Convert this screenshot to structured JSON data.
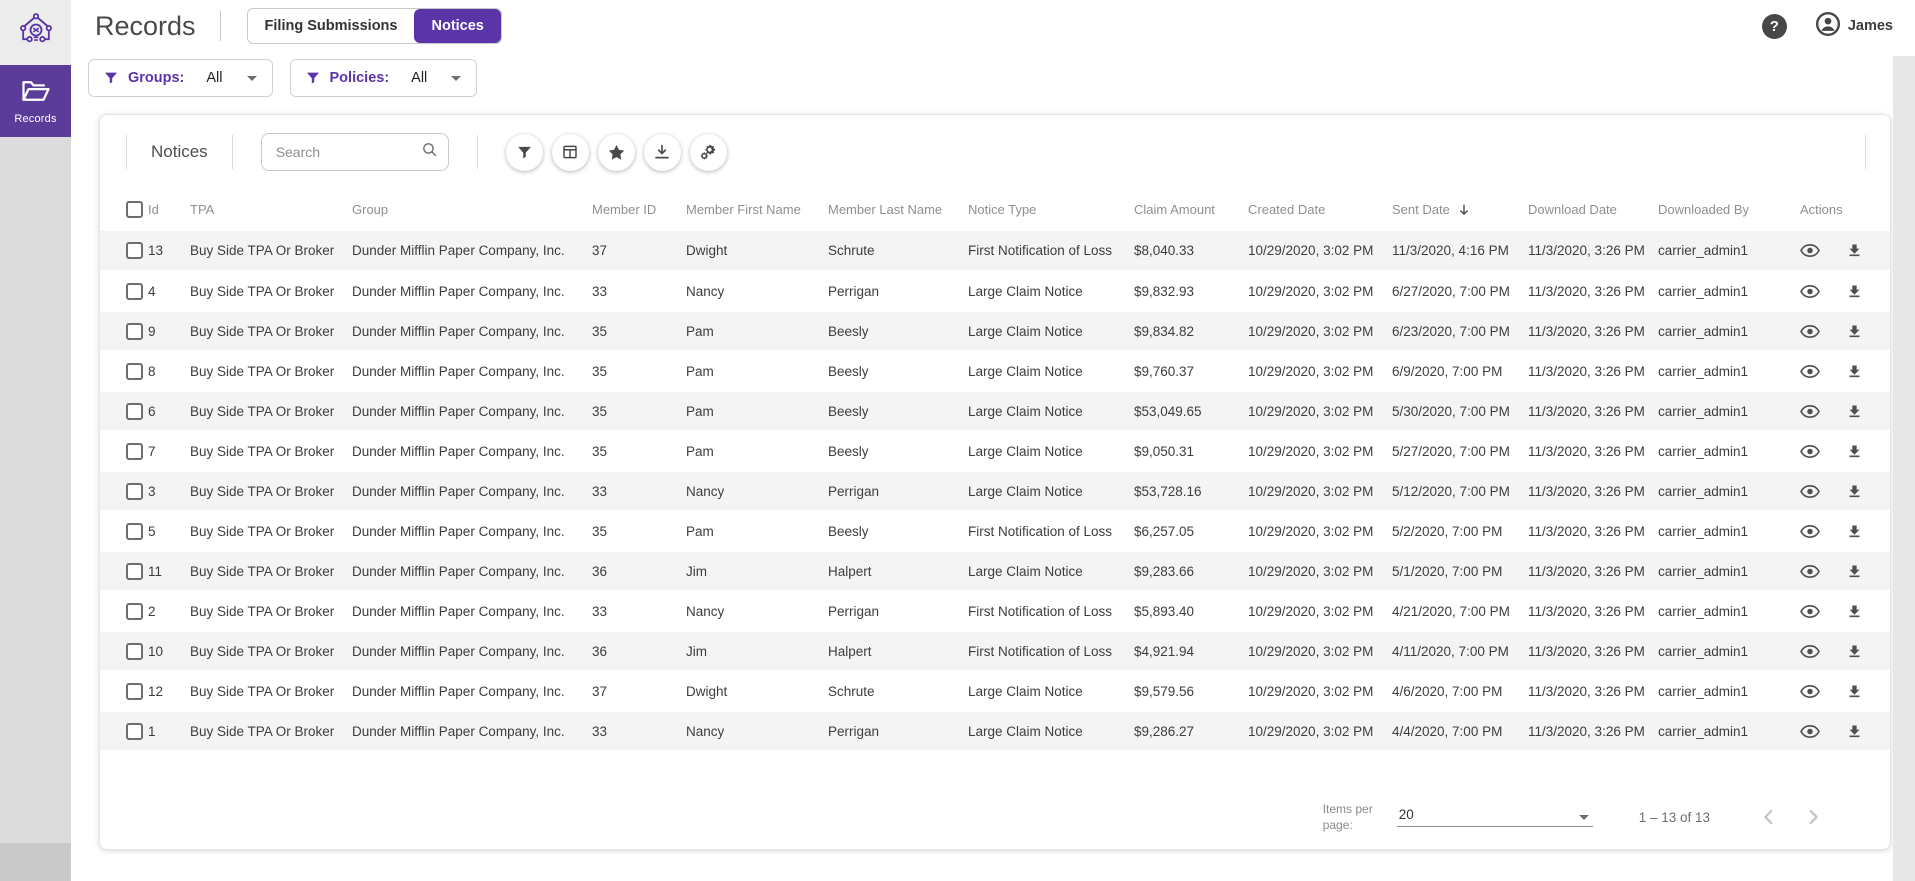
{
  "app": {
    "title": "Records",
    "help_label": "?",
    "user_name": "James"
  },
  "sidebar": {
    "records_label": "Records"
  },
  "tabs": [
    {
      "label": "Filing Submissions",
      "active": false
    },
    {
      "label": "Notices",
      "active": true
    }
  ],
  "filters": [
    {
      "label": "Groups:",
      "value": "All"
    },
    {
      "label": "Policies:",
      "value": "All"
    }
  ],
  "panel": {
    "title": "Notices",
    "search_placeholder": "Search",
    "toolbar_icons": [
      "filter-icon",
      "columns-icon",
      "favorite-star-icon",
      "download-icon",
      "settings-gears-icon"
    ]
  },
  "table": {
    "columns": [
      {
        "key": "select",
        "label": ""
      },
      {
        "key": "id",
        "label": "Id"
      },
      {
        "key": "tpa",
        "label": "TPA"
      },
      {
        "key": "group",
        "label": "Group"
      },
      {
        "key": "member_id",
        "label": "Member ID"
      },
      {
        "key": "member_first_name",
        "label": "Member First Name"
      },
      {
        "key": "member_last_name",
        "label": "Member Last Name"
      },
      {
        "key": "notice_type",
        "label": "Notice Type"
      },
      {
        "key": "claim_amount",
        "label": "Claim Amount"
      },
      {
        "key": "created_date",
        "label": "Created Date"
      },
      {
        "key": "sent_date",
        "label": "Sent Date",
        "sorted": "desc"
      },
      {
        "key": "download_date",
        "label": "Download Date"
      },
      {
        "key": "downloaded_by",
        "label": "Downloaded By"
      },
      {
        "key": "actions",
        "label": "Actions"
      }
    ],
    "rows": [
      {
        "id": "13",
        "tpa": "Buy Side TPA Or Broker",
        "group": "Dunder Mifflin Paper Company, Inc.",
        "member_id": "37",
        "member_first_name": "Dwight",
        "member_last_name": "Schrute",
        "notice_type": "First Notification of Loss",
        "claim_amount": "$8,040.33",
        "created_date": "10/29/2020, 3:02 PM",
        "sent_date": "11/3/2020, 4:16 PM",
        "download_date": "11/3/2020, 3:26 PM",
        "downloaded_by": "carrier_admin1"
      },
      {
        "id": "4",
        "tpa": "Buy Side TPA Or Broker",
        "group": "Dunder Mifflin Paper Company, Inc.",
        "member_id": "33",
        "member_first_name": "Nancy",
        "member_last_name": "Perrigan",
        "notice_type": "Large Claim Notice",
        "claim_amount": "$9,832.93",
        "created_date": "10/29/2020, 3:02 PM",
        "sent_date": "6/27/2020, 7:00 PM",
        "download_date": "11/3/2020, 3:26 PM",
        "downloaded_by": "carrier_admin1"
      },
      {
        "id": "9",
        "tpa": "Buy Side TPA Or Broker",
        "group": "Dunder Mifflin Paper Company, Inc.",
        "member_id": "35",
        "member_first_name": "Pam",
        "member_last_name": "Beesly",
        "notice_type": "Large Claim Notice",
        "claim_amount": "$9,834.82",
        "created_date": "10/29/2020, 3:02 PM",
        "sent_date": "6/23/2020, 7:00 PM",
        "download_date": "11/3/2020, 3:26 PM",
        "downloaded_by": "carrier_admin1"
      },
      {
        "id": "8",
        "tpa": "Buy Side TPA Or Broker",
        "group": "Dunder Mifflin Paper Company, Inc.",
        "member_id": "35",
        "member_first_name": "Pam",
        "member_last_name": "Beesly",
        "notice_type": "Large Claim Notice",
        "claim_amount": "$9,760.37",
        "created_date": "10/29/2020, 3:02 PM",
        "sent_date": "6/9/2020, 7:00 PM",
        "download_date": "11/3/2020, 3:26 PM",
        "downloaded_by": "carrier_admin1"
      },
      {
        "id": "6",
        "tpa": "Buy Side TPA Or Broker",
        "group": "Dunder Mifflin Paper Company, Inc.",
        "member_id": "35",
        "member_first_name": "Pam",
        "member_last_name": "Beesly",
        "notice_type": "Large Claim Notice",
        "claim_amount": "$53,049.65",
        "created_date": "10/29/2020, 3:02 PM",
        "sent_date": "5/30/2020, 7:00 PM",
        "download_date": "11/3/2020, 3:26 PM",
        "downloaded_by": "carrier_admin1"
      },
      {
        "id": "7",
        "tpa": "Buy Side TPA Or Broker",
        "group": "Dunder Mifflin Paper Company, Inc.",
        "member_id": "35",
        "member_first_name": "Pam",
        "member_last_name": "Beesly",
        "notice_type": "Large Claim Notice",
        "claim_amount": "$9,050.31",
        "created_date": "10/29/2020, 3:02 PM",
        "sent_date": "5/27/2020, 7:00 PM",
        "download_date": "11/3/2020, 3:26 PM",
        "downloaded_by": "carrier_admin1"
      },
      {
        "id": "3",
        "tpa": "Buy Side TPA Or Broker",
        "group": "Dunder Mifflin Paper Company, Inc.",
        "member_id": "33",
        "member_first_name": "Nancy",
        "member_last_name": "Perrigan",
        "notice_type": "Large Claim Notice",
        "claim_amount": "$53,728.16",
        "created_date": "10/29/2020, 3:02 PM",
        "sent_date": "5/12/2020, 7:00 PM",
        "download_date": "11/3/2020, 3:26 PM",
        "downloaded_by": "carrier_admin1"
      },
      {
        "id": "5",
        "tpa": "Buy Side TPA Or Broker",
        "group": "Dunder Mifflin Paper Company, Inc.",
        "member_id": "35",
        "member_first_name": "Pam",
        "member_last_name": "Beesly",
        "notice_type": "First Notification of Loss",
        "claim_amount": "$6,257.05",
        "created_date": "10/29/2020, 3:02 PM",
        "sent_date": "5/2/2020, 7:00 PM",
        "download_date": "11/3/2020, 3:26 PM",
        "downloaded_by": "carrier_admin1"
      },
      {
        "id": "11",
        "tpa": "Buy Side TPA Or Broker",
        "group": "Dunder Mifflin Paper Company, Inc.",
        "member_id": "36",
        "member_first_name": "Jim",
        "member_last_name": "Halpert",
        "notice_type": "Large Claim Notice",
        "claim_amount": "$9,283.66",
        "created_date": "10/29/2020, 3:02 PM",
        "sent_date": "5/1/2020, 7:00 PM",
        "download_date": "11/3/2020, 3:26 PM",
        "downloaded_by": "carrier_admin1"
      },
      {
        "id": "2",
        "tpa": "Buy Side TPA Or Broker",
        "group": "Dunder Mifflin Paper Company, Inc.",
        "member_id": "33",
        "member_first_name": "Nancy",
        "member_last_name": "Perrigan",
        "notice_type": "First Notification of Loss",
        "claim_amount": "$5,893.40",
        "created_date": "10/29/2020, 3:02 PM",
        "sent_date": "4/21/2020, 7:00 PM",
        "download_date": "11/3/2020, 3:26 PM",
        "downloaded_by": "carrier_admin1"
      },
      {
        "id": "10",
        "tpa": "Buy Side TPA Or Broker",
        "group": "Dunder Mifflin Paper Company, Inc.",
        "member_id": "36",
        "member_first_name": "Jim",
        "member_last_name": "Halpert",
        "notice_type": "First Notification of Loss",
        "claim_amount": "$4,921.94",
        "created_date": "10/29/2020, 3:02 PM",
        "sent_date": "4/11/2020, 7:00 PM",
        "download_date": "11/3/2020, 3:26 PM",
        "downloaded_by": "carrier_admin1"
      },
      {
        "id": "12",
        "tpa": "Buy Side TPA Or Broker",
        "group": "Dunder Mifflin Paper Company, Inc.",
        "member_id": "37",
        "member_first_name": "Dwight",
        "member_last_name": "Schrute",
        "notice_type": "Large Claim Notice",
        "claim_amount": "$9,579.56",
        "created_date": "10/29/2020, 3:02 PM",
        "sent_date": "4/6/2020, 7:00 PM",
        "download_date": "11/3/2020, 3:26 PM",
        "downloaded_by": "carrier_admin1"
      },
      {
        "id": "1",
        "tpa": "Buy Side TPA Or Broker",
        "group": "Dunder Mifflin Paper Company, Inc.",
        "member_id": "33",
        "member_first_name": "Nancy",
        "member_last_name": "Perrigan",
        "notice_type": "Large Claim Notice",
        "claim_amount": "$9,286.27",
        "created_date": "10/29/2020, 3:02 PM",
        "sent_date": "4/4/2020, 7:00 PM",
        "download_date": "11/3/2020, 3:26 PM",
        "downloaded_by": "carrier_admin1"
      }
    ]
  },
  "pagination": {
    "items_per_page_label": "Items per page:",
    "page_size": "20",
    "range": "1 – 13 of 13"
  },
  "colors": {
    "accent_purple": "#5b34a8",
    "sidebar_purple": "#5b3d99",
    "row_stripe": "#f4f4f4",
    "header_text": "#8f8f8f"
  }
}
